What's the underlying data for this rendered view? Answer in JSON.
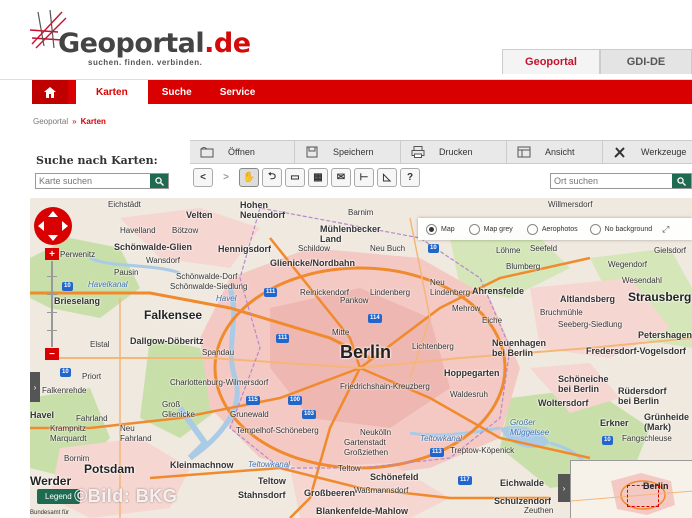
{
  "header": {
    "logo_title": "Geoportal",
    "logo_tld": ".de",
    "tagline": "suchen. finden. verbinden.",
    "site_tabs": [
      {
        "label": "Geoportal",
        "active": true
      },
      {
        "label": "GDI-DE",
        "active": false
      }
    ]
  },
  "nav": {
    "items": [
      {
        "label": "Karten",
        "active": true
      },
      {
        "label": "Suche",
        "active": false
      },
      {
        "label": "Service",
        "active": false
      }
    ]
  },
  "breadcrumb": {
    "root": "Geoportal",
    "current": "Karten"
  },
  "search": {
    "title": "Suche nach Karten:",
    "placeholder": "Karte suchen"
  },
  "place_search": {
    "placeholder": "Ort suchen"
  },
  "toolbar": {
    "items": [
      {
        "label": "Öffnen",
        "icon": "open-icon"
      },
      {
        "label": "Speichern",
        "icon": "save-icon"
      },
      {
        "label": "Drucken",
        "icon": "print-icon"
      },
      {
        "label": "Ansicht",
        "icon": "view-icon"
      },
      {
        "label": "Werkzeuge",
        "icon": "tools-icon"
      }
    ],
    "tools": [
      "back-icon",
      "forward-icon",
      "pan-hand-icon",
      "query-icon",
      "zoom-box-icon",
      "measure-area-icon",
      "email-icon",
      "measure-line-icon",
      "measure-angle-icon",
      "help-icon"
    ]
  },
  "map": {
    "layers": [
      {
        "label": "Map",
        "selected": true
      },
      {
        "label": "Map grey",
        "selected": false
      },
      {
        "label": "Aerophotos",
        "selected": false
      },
      {
        "label": "No background",
        "selected": false
      }
    ],
    "city": "Berlin",
    "labels": {
      "eichstadt": "Eichstädt",
      "velten": "Velten",
      "hohen_neuendorf": "Hohen\nNeuendorf",
      "havelland": "Havelland",
      "botzow": "Bötzow",
      "schoenwalde_glien": "Schönwalde-Glien",
      "hennigsdorf": "Hennigsdorf",
      "schildow": "Schildow",
      "muehlenbecker_land": "Mühlenbecker\nLand",
      "neu_buch": "Neu Buch",
      "perwenitz": "Perwenitz",
      "wansdorf": "Wansdorf",
      "glienicke": "Glienicke/Nordbahn",
      "pausin": "Pausin",
      "schoenwalde_dorf": "Schönwalde-Dorf",
      "schoenwalde_siedlung": "Schönwalde-Siedlung",
      "havelkanal": "Havelkanal",
      "havel": "Havel",
      "reinickendorf": "Reinickendorf",
      "lindenberg": "Lindenberg",
      "neu_lindenberg": "Neu\nLindenberg",
      "pankow": "Pankow",
      "ahrensfelde": "Ahrensfelde",
      "maehrow": "Mehrow",
      "brieselang": "Brieselang",
      "falkensee": "Falkensee",
      "mitte": "Mitte",
      "eiche": "Eiche",
      "dallgow": "Dallgow-Döberitz",
      "elstal": "Elstal",
      "spandau": "Spandau",
      "lichtenberg": "Lichtenberg",
      "neuenhagen": "Neuenhagen\nbei Berlin",
      "fredersdorf": "Fredersdorf-Vogelsdorf",
      "priort": "Priort",
      "falkenrehde": "Falkenrehde",
      "charlottenburg": "Charlottenburg-Wilmersdorf",
      "friedrichshain": "Friedrichshain-Kreuzberg",
      "hoppegarten": "Hoppegarten",
      "waldesruh": "Waldesruh",
      "schoeneiche": "Schöneiche\nbei Berlin",
      "ruedersdorf": "Rüdersdorf\nbei Berlin",
      "woltersdorf": "Woltersdorf",
      "gross_glienicke": "Groß\nGlienicke",
      "havel_2": "Havel",
      "fahrland": "Fahrland",
      "gruenewald": "Grunewald",
      "tempelhof": "Tempelhof-Schöneberg",
      "neukoelln": "Neukölln",
      "krampnitz": "Krampnitz",
      "marquardt": "Marquardt",
      "neu_fahrland": "Neu\nFahrland",
      "gartenstadt": "Gartenstadt\nGroßziethen",
      "teltowkanal": "Teltowkanal",
      "treptow": "Treptow-Köpenick",
      "mueggelsee": "Großer\nMüggelsee",
      "erkner": "Erkner",
      "gruenheide": "Grünheide\n(Mark)",
      "fangschleuse": "Fangschleuse",
      "bornim": "Bornim",
      "potsdam": "Potsdam",
      "kleinmachnow": "Kleinmachnow",
      "teltow": "Teltow",
      "teltowkanal_2": "Teltowkanal",
      "schoenefeld": "Schönefeld",
      "wassmannsdorf": "Waßmannsdorf",
      "eichwalde": "Eichwalde",
      "werder": "Werder",
      "stahnsdorf": "Stahnsdorf",
      "grossbeeren": "Großbeeren",
      "blankenfelde": "Blankenfelde-Mahlow",
      "schulzendorf": "Schulzendorf",
      "zeuthen": "Zeuthen",
      "strausberg": "Strausberg",
      "altlandsberg": "Altlandsberg",
      "bruchmuehle": "Bruchmühle",
      "seeberg": "Seeberg-Siedlung",
      "petershagen": "Petershagen/Eg",
      "blumberg": "Blumberg",
      "loehme": "Löhme",
      "seefeld": "Seefeld",
      "wegendorf": "Wegendorf",
      "wesendahl": "Wesendahl",
      "willmersdorf": "Willmersdorf",
      "gielsdorf": "Gielsdorf",
      "barnim": "Barnim"
    },
    "roads": [
      "10",
      "114",
      "111",
      "100",
      "115",
      "103",
      "113",
      "117",
      "10",
      "10"
    ],
    "legend_label": "Legend",
    "watermark": "©Bild: BKG",
    "attribution": "Bundesamt für",
    "overview_label": "Berlin"
  },
  "colors": {
    "brand_red": "#d80000",
    "search_green": "#1f6b52",
    "urban_pink": "#f4c9c4",
    "forest_green": "#c9dfa9",
    "water_blue": "#a9cbe6"
  }
}
